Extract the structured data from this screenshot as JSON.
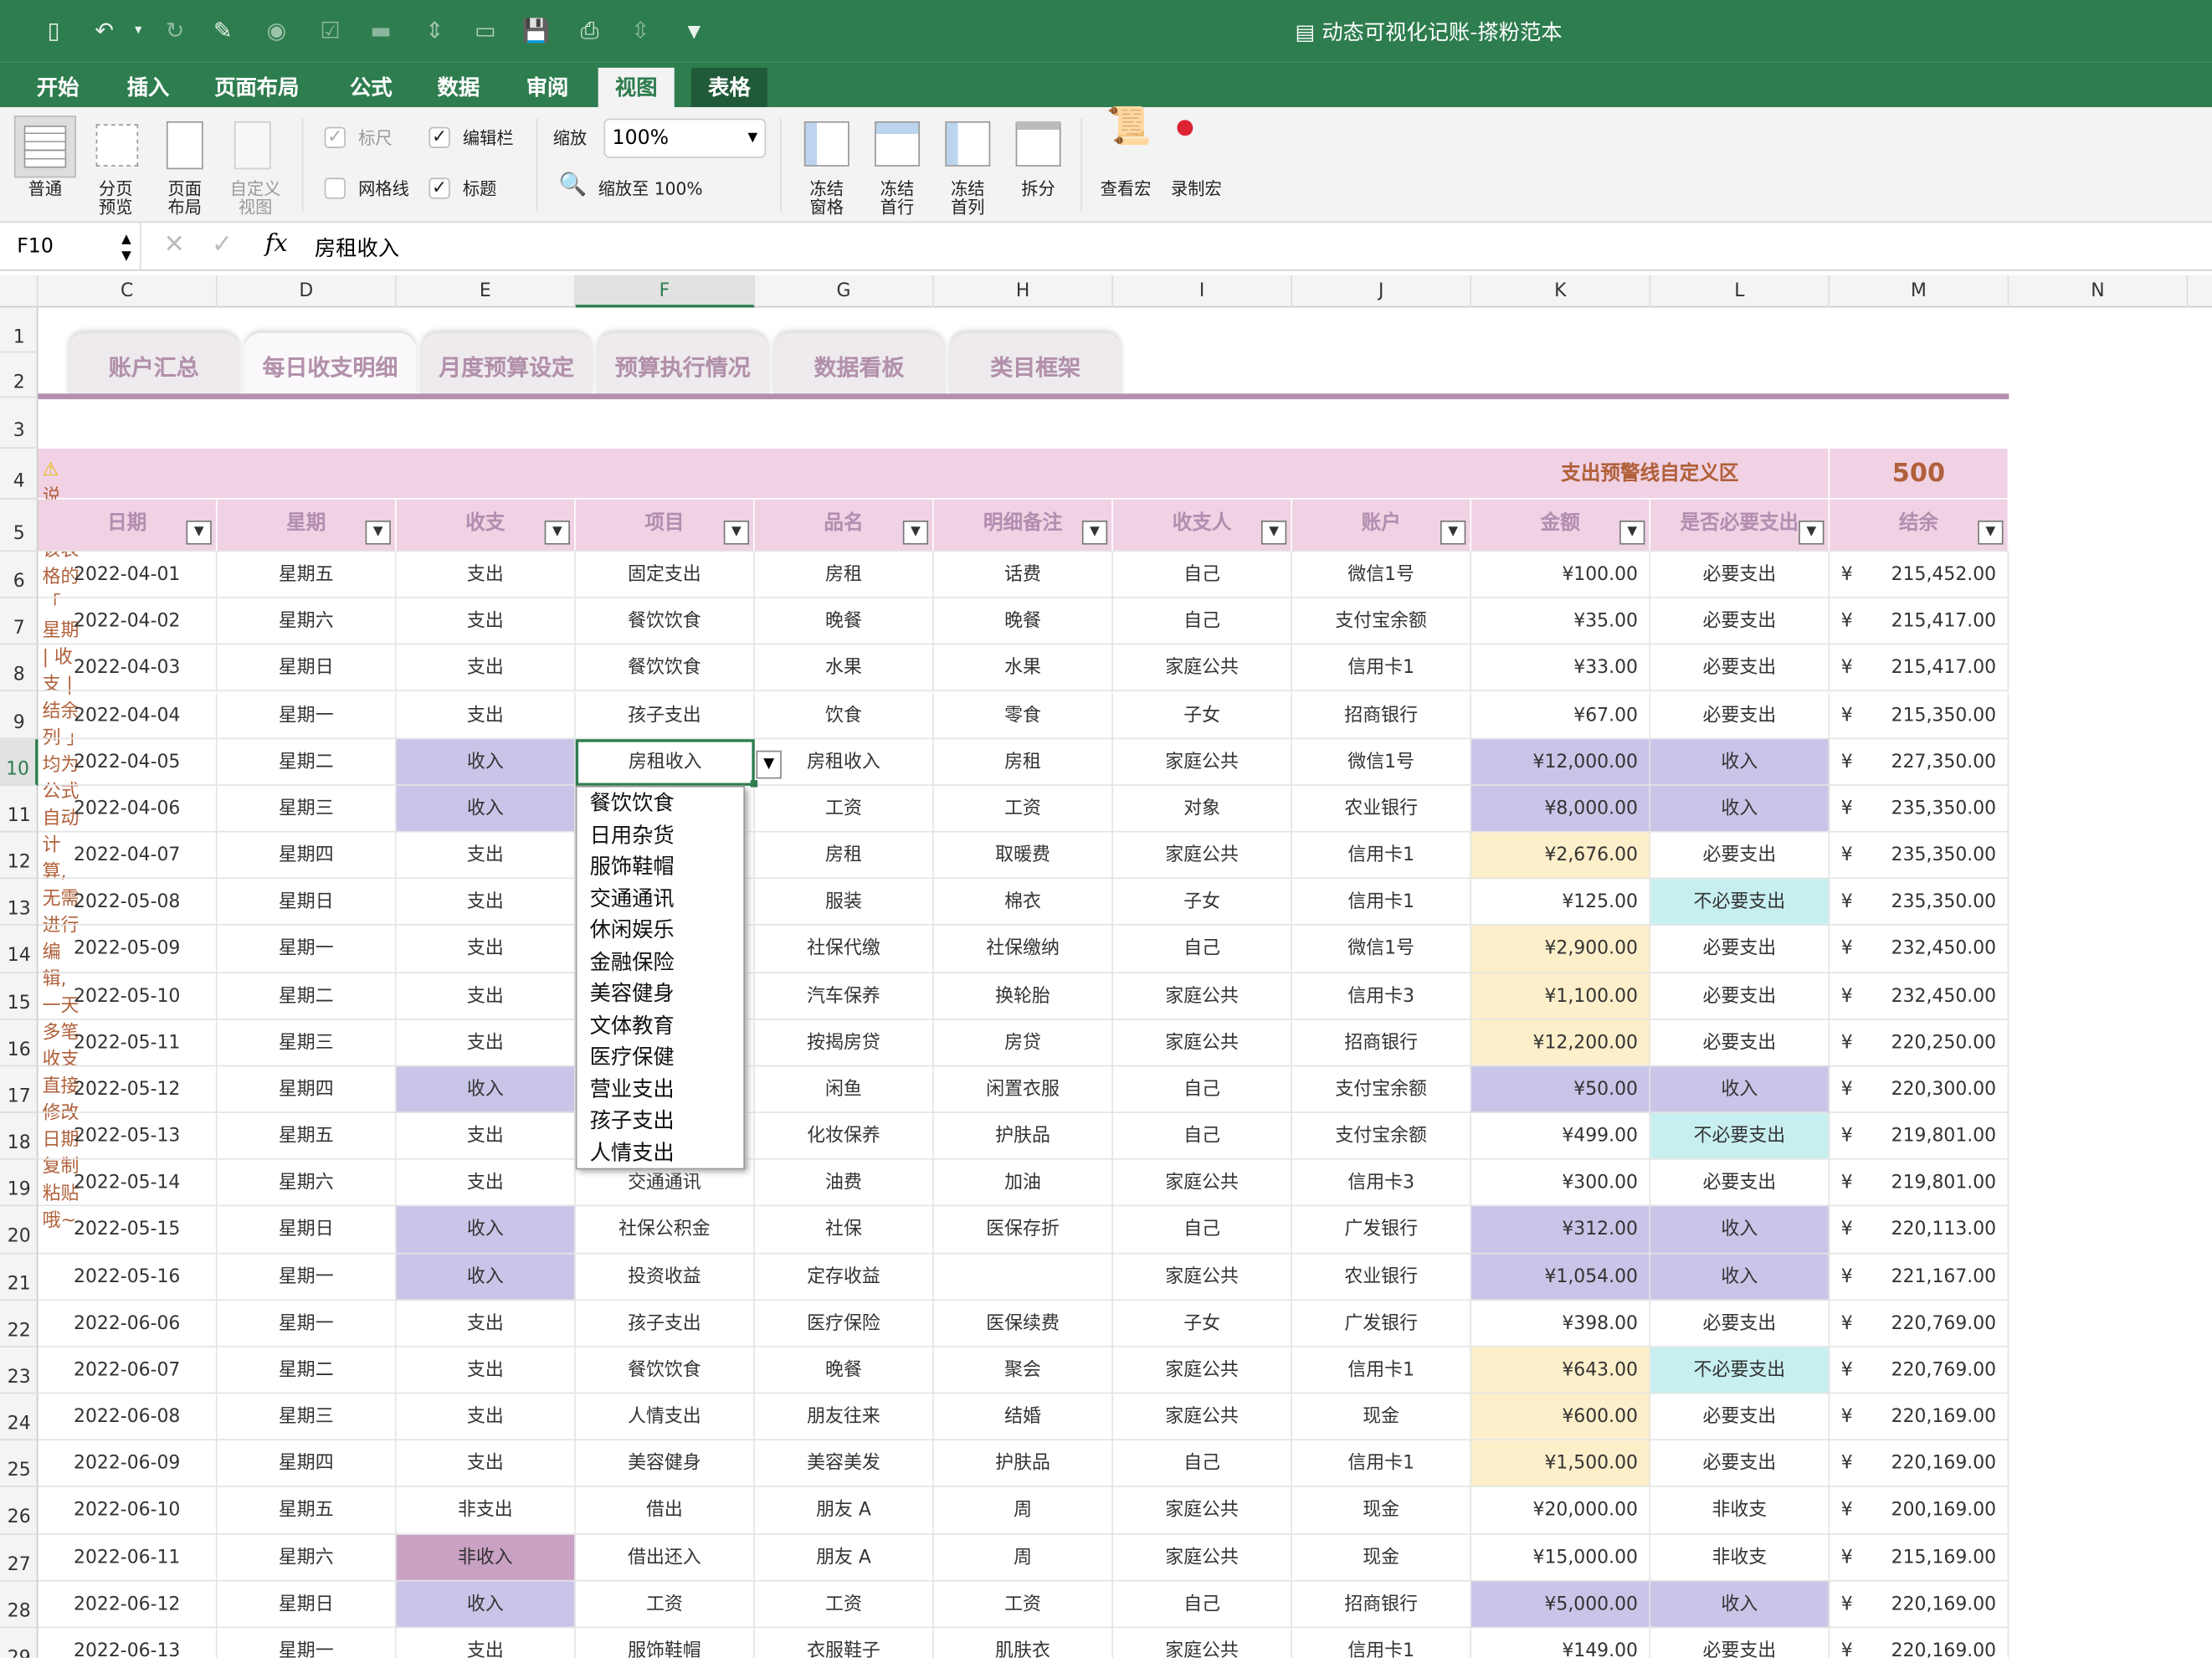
{
  "window": {
    "title": "动态可视化记账-搽粉范本"
  },
  "ribbon_tabs": [
    "开始",
    "插入",
    "页面布局",
    "公式",
    "数据",
    "审阅",
    "视图",
    "表格"
  ],
  "active_ribbon_tab": "视图",
  "ribbon": {
    "views": [
      "普通",
      "分页\n预览",
      "页面\n布局",
      "自定义\n视图"
    ],
    "show": {
      "ruler": "标尺",
      "formula_bar": "编辑栏",
      "gridlines": "网格线",
      "headings": "标题",
      "ruler_checked": true,
      "formula_bar_checked": true,
      "gridlines_checked": false,
      "headings_checked": true
    },
    "zoom_label": "缩放",
    "zoom_value": "100%",
    "zoom_to_100": "缩放至 100%",
    "freeze": [
      "冻结\n窗格",
      "冻结\n首行",
      "冻结\n首列",
      "拆分"
    ],
    "macros": [
      "查看宏",
      "录制宏"
    ]
  },
  "formula_bar": {
    "name_box": "F10",
    "fx": "fx",
    "content": "房租收入"
  },
  "columns": [
    "C",
    "D",
    "E",
    "F",
    "G",
    "H",
    "I",
    "J",
    "K",
    "L",
    "M",
    "N"
  ],
  "rows": [
    "1",
    "2",
    "3",
    "4",
    "5",
    "6",
    "7",
    "8",
    "9",
    "10",
    "11",
    "12",
    "13",
    "14",
    "15",
    "16",
    "17",
    "18",
    "19",
    "20",
    "21",
    "22",
    "23",
    "24",
    "25",
    "26",
    "27",
    "28",
    "29"
  ],
  "sheet_tabs": [
    "账户汇总",
    "每日收支明细",
    "月度预算设定",
    "预算执行情况",
    "数据看板",
    "类目框架"
  ],
  "active_sheet_tab": "每日收支明细",
  "notice": "说明：该表格的「 星期 | 收支 | 结余列 」均为公式自动计算, 无需进行编辑, 一天多笔收支直接修改日期复制粘贴哦~",
  "warning_area_label": "支出预警线自定义区",
  "warning_value": "500",
  "headers": [
    "日期",
    "星期",
    "收支",
    "项目",
    "品名",
    "明细备注",
    "收支人",
    "账户",
    "金额",
    "是否必要支出",
    "结余"
  ],
  "currency": "¥",
  "data": [
    [
      "2022-04-01",
      "星期五",
      "支出",
      "固定支出",
      "房租",
      "话费",
      "自己",
      "微信1号",
      "¥100.00",
      "必要支出",
      "215,452.00"
    ],
    [
      "2022-04-02",
      "星期六",
      "支出",
      "餐饮饮食",
      "晚餐",
      "晚餐",
      "自己",
      "支付宝余额",
      "¥35.00",
      "必要支出",
      "215,417.00"
    ],
    [
      "2022-04-03",
      "星期日",
      "支出",
      "餐饮饮食",
      "水果",
      "水果",
      "家庭公共",
      "信用卡1",
      "¥33.00",
      "必要支出",
      "215,417.00"
    ],
    [
      "2022-04-04",
      "星期一",
      "支出",
      "孩子支出",
      "饮食",
      "零食",
      "子女",
      "招商银行",
      "¥67.00",
      "必要支出",
      "215,350.00"
    ],
    [
      "2022-04-05",
      "星期二",
      "收入",
      "房租收入",
      "房租收入",
      "房租",
      "家庭公共",
      "微信1号",
      "¥12,000.00",
      "收入",
      "227,350.00"
    ],
    [
      "2022-04-06",
      "星期三",
      "收入",
      "",
      "工资",
      "工资",
      "对象",
      "农业银行",
      "¥8,000.00",
      "收入",
      "235,350.00"
    ],
    [
      "2022-04-07",
      "星期四",
      "支出",
      "",
      "房租",
      "取暖费",
      "家庭公共",
      "信用卡1",
      "¥2,676.00",
      "必要支出",
      "235,350.00"
    ],
    [
      "2022-05-08",
      "星期日",
      "支出",
      "",
      "服装",
      "棉衣",
      "子女",
      "信用卡1",
      "¥125.00",
      "不必要支出",
      "235,350.00"
    ],
    [
      "2022-05-09",
      "星期一",
      "支出",
      "",
      "社保代缴",
      "社保缴纳",
      "自己",
      "微信1号",
      "¥2,900.00",
      "必要支出",
      "232,450.00"
    ],
    [
      "2022-05-10",
      "星期二",
      "支出",
      "",
      "汽车保养",
      "换轮胎",
      "家庭公共",
      "信用卡3",
      "¥1,100.00",
      "必要支出",
      "232,450.00"
    ],
    [
      "2022-05-11",
      "星期三",
      "支出",
      "",
      "按揭房贷",
      "房贷",
      "家庭公共",
      "招商银行",
      "¥12,200.00",
      "必要支出",
      "220,250.00"
    ],
    [
      "2022-05-12",
      "星期四",
      "收入",
      "",
      "闲鱼",
      "闲置衣服",
      "自己",
      "支付宝余额",
      "¥50.00",
      "收入",
      "220,300.00"
    ],
    [
      "2022-05-13",
      "星期五",
      "支出",
      "",
      "化妆保养",
      "护肤品",
      "自己",
      "支付宝余额",
      "¥499.00",
      "不必要支出",
      "219,801.00"
    ],
    [
      "2022-05-14",
      "星期六",
      "支出",
      "交通通讯",
      "油费",
      "加油",
      "家庭公共",
      "信用卡3",
      "¥300.00",
      "必要支出",
      "219,801.00"
    ],
    [
      "2022-05-15",
      "星期日",
      "收入",
      "社保公积金",
      "社保",
      "医保存折",
      "自己",
      "广发银行",
      "¥312.00",
      "收入",
      "220,113.00"
    ],
    [
      "2022-05-16",
      "星期一",
      "收入",
      "投资收益",
      "定存收益",
      "",
      "家庭公共",
      "农业银行",
      "¥1,054.00",
      "收入",
      "221,167.00"
    ],
    [
      "2022-06-06",
      "星期一",
      "支出",
      "孩子支出",
      "医疗保险",
      "医保续费",
      "子女",
      "广发银行",
      "¥398.00",
      "必要支出",
      "220,769.00"
    ],
    [
      "2022-06-07",
      "星期二",
      "支出",
      "餐饮饮食",
      "晚餐",
      "聚会",
      "家庭公共",
      "信用卡1",
      "¥643.00",
      "不必要支出",
      "220,769.00"
    ],
    [
      "2022-06-08",
      "星期三",
      "支出",
      "人情支出",
      "朋友往来",
      "结婚",
      "家庭公共",
      "现金",
      "¥600.00",
      "必要支出",
      "220,169.00"
    ],
    [
      "2022-06-09",
      "星期四",
      "支出",
      "美容健身",
      "美容美发",
      "护肤品",
      "自己",
      "信用卡1",
      "¥1,500.00",
      "必要支出",
      "220,169.00"
    ],
    [
      "2022-06-10",
      "星期五",
      "非支出",
      "借出",
      "朋友 A",
      "周",
      "家庭公共",
      "现金",
      "¥20,000.00",
      "非收支",
      "200,169.00"
    ],
    [
      "2022-06-11",
      "星期六",
      "非收入",
      "借出还入",
      "朋友 A",
      "周",
      "家庭公共",
      "现金",
      "¥15,000.00",
      "非收支",
      "215,169.00"
    ],
    [
      "2022-06-12",
      "星期日",
      "收入",
      "工资",
      "工资",
      "工资",
      "自己",
      "招商银行",
      "¥5,000.00",
      "收入",
      "220,169.00"
    ],
    [
      "2022-06-13",
      "星期一",
      "支出",
      "服饰鞋帽",
      "衣服鞋子",
      "肌肤衣",
      "家庭公共",
      "信用卡1",
      "¥149.00",
      "必要支出",
      "220,169.00"
    ]
  ],
  "highlight_over_warning": [
    6,
    8,
    9,
    10,
    17,
    18,
    19
  ],
  "dropdown": {
    "items": [
      "餐饮饮食",
      "日用杂货",
      "服饰鞋帽",
      "交通通讯",
      "休闲娱乐",
      "金融保险",
      "美容健身",
      "文体教育",
      "医疗保健",
      "营业支出",
      "孩子支出",
      "人情支出"
    ]
  },
  "colors": {
    "accent": "#2e7d4f",
    "income": "#c8c5e8",
    "non_income": "#c9a1c3",
    "over_warning": "#fdefc9",
    "unnecessary": "#c8eff0",
    "header": "#f0d2e4",
    "tab_text": "#b290aa"
  }
}
